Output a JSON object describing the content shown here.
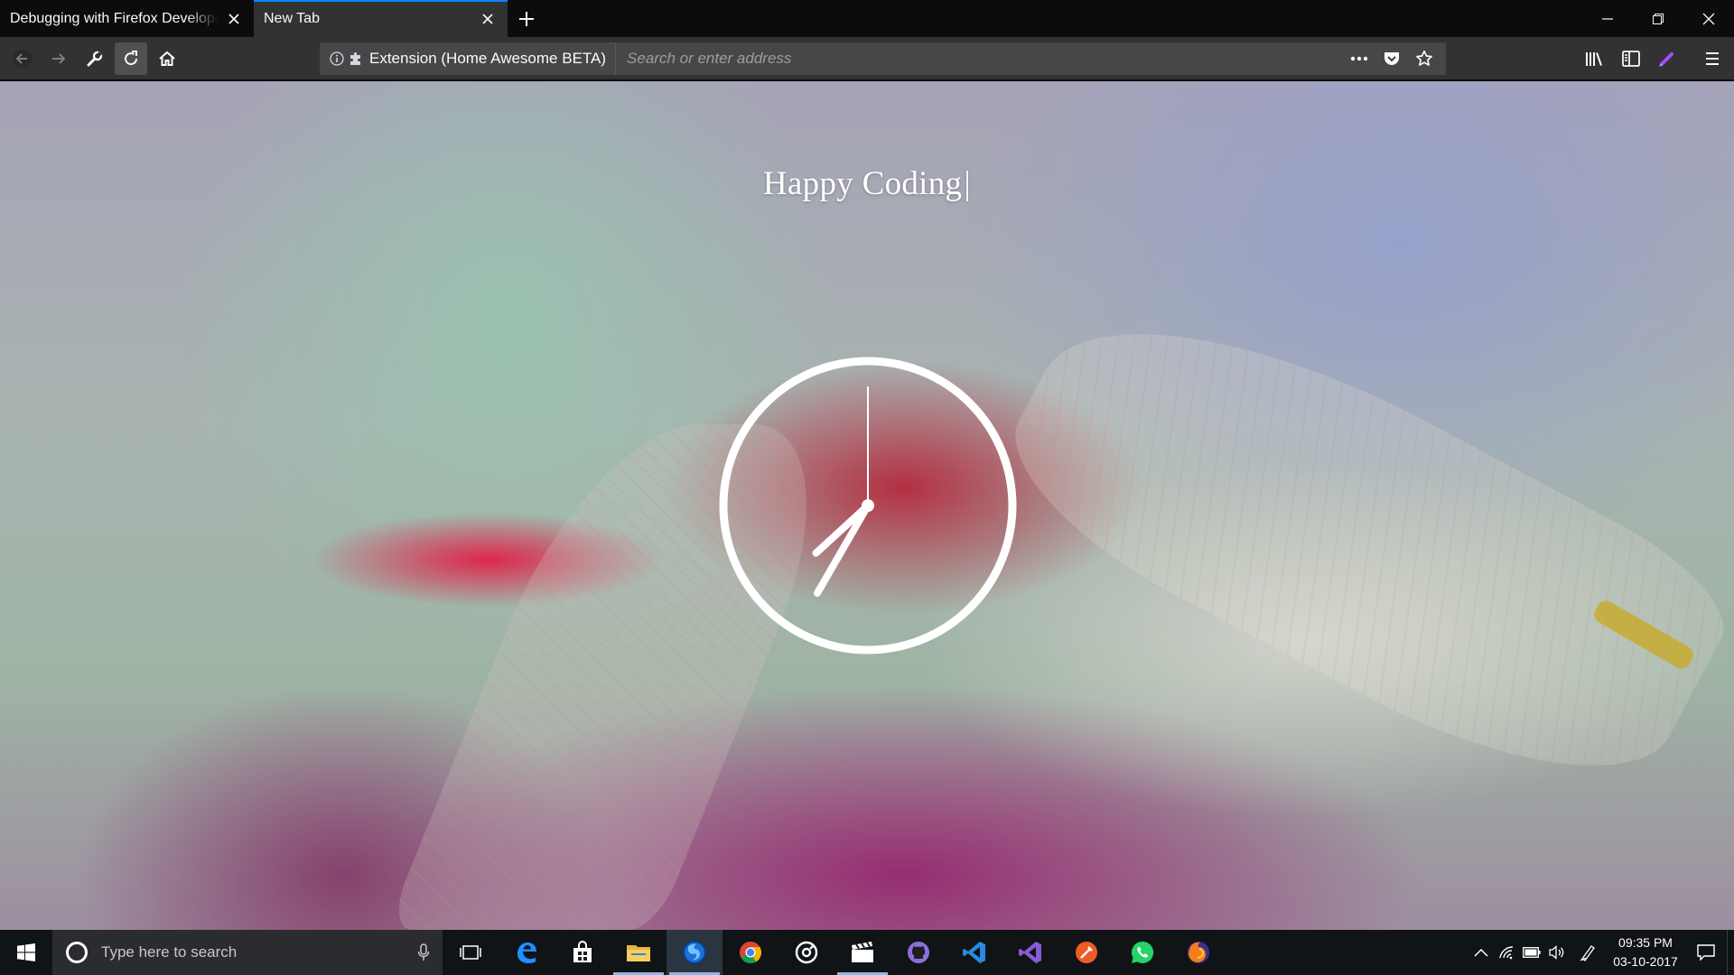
{
  "tabs": [
    {
      "label": "Debugging with Firefox Developer",
      "active": false
    },
    {
      "label": "New Tab",
      "active": true
    }
  ],
  "urlbar": {
    "identity_label": "Extension (Home Awesome BETA)",
    "placeholder": "Search or enter address",
    "value": ""
  },
  "page": {
    "greeting": "Happy Coding",
    "caret": "|"
  },
  "clock": {
    "hour": 7,
    "minute": 35,
    "second": 0
  },
  "taskbar": {
    "search_placeholder": "Type here to search",
    "time": "09:35 PM",
    "date": "03-10-2017",
    "apps": [
      {
        "name": "task-view",
        "running": false
      },
      {
        "name": "edge",
        "running": false
      },
      {
        "name": "store",
        "running": false
      },
      {
        "name": "file-explorer",
        "running": true
      },
      {
        "name": "firefox-developer-edition",
        "running": true,
        "active": true
      },
      {
        "name": "chrome",
        "running": false
      },
      {
        "name": "groove-music",
        "running": false
      },
      {
        "name": "movies-tv",
        "running": true
      },
      {
        "name": "github-desktop",
        "running": false
      },
      {
        "name": "vs-code",
        "running": false
      },
      {
        "name": "visual-studio",
        "running": false
      },
      {
        "name": "postman",
        "running": false
      },
      {
        "name": "whatsapp",
        "running": false
      },
      {
        "name": "firefox",
        "running": false
      }
    ]
  },
  "colors": {
    "tab_accent": "#0a84ff",
    "toolbar": "#323234",
    "tabstrip": "#0c0c0d",
    "taskbar": "#101417"
  }
}
